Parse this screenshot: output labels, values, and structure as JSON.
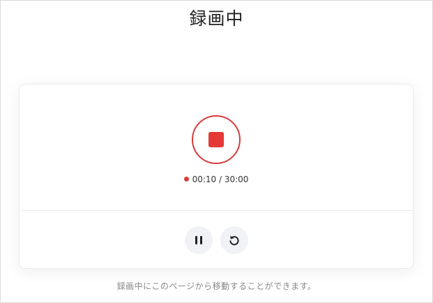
{
  "page": {
    "title": "録画中"
  },
  "recorder": {
    "elapsed": "00:10",
    "separator": " / ",
    "limit": "30:00",
    "state": "recording"
  },
  "controls": {
    "stop_icon": "stop-icon",
    "pause_icon": "pause-icon",
    "reset_icon": "rotate-ccw-icon"
  },
  "footer": {
    "notice": "録画中にこのページから移動することができます。"
  },
  "colors": {
    "accent_red": "#e53935",
    "ring_red": "#d93b3b",
    "button_bg": "#f1f2f5",
    "text_muted": "#888888"
  }
}
